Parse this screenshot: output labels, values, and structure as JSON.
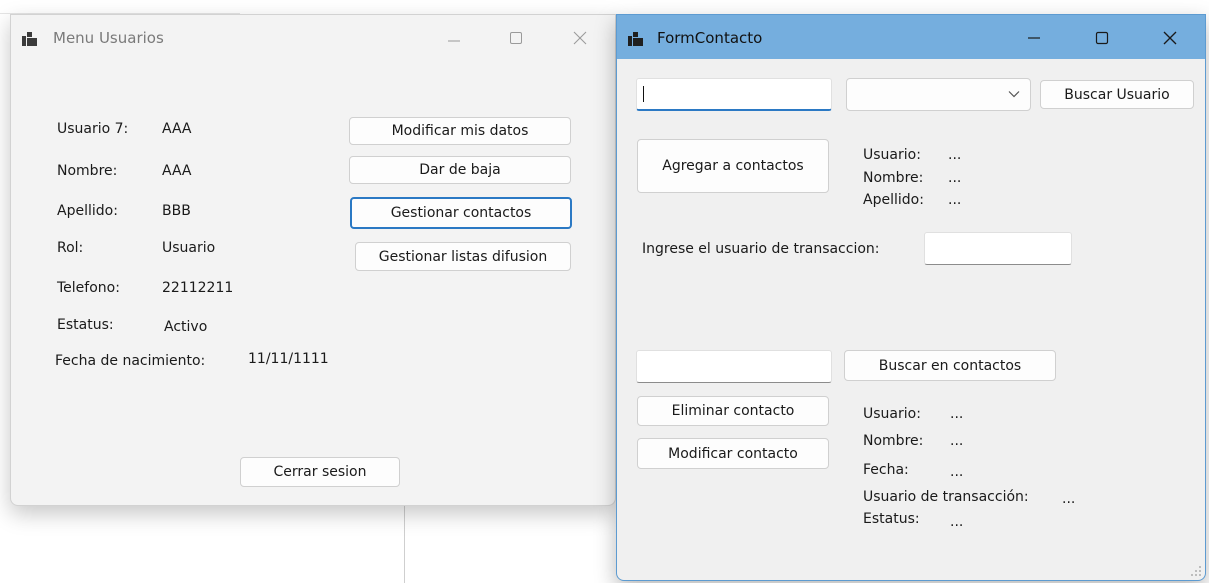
{
  "menu_window": {
    "title": "Menu Usuarios",
    "fields": [
      {
        "label": "Usuario 7:",
        "value": "AAA"
      },
      {
        "label": "Nombre:",
        "value": "AAA"
      },
      {
        "label": "Apellido:",
        "value": "BBB"
      },
      {
        "label": "Rol:",
        "value": "Usuario"
      },
      {
        "label": "Telefono:",
        "value": "22112211"
      },
      {
        "label": "Estatus:",
        "value": "Activo"
      },
      {
        "label": "Fecha de nacimiento:",
        "value": "11/11/1111"
      }
    ],
    "buttons": {
      "modify": "Modificar mis datos",
      "deactivate": "Dar de baja",
      "manage_contacts": "Gestionar contactos",
      "manage_lists": "Gestionar listas difusion",
      "logout": "Cerrar sesion"
    }
  },
  "contact_window": {
    "title": "FormContacto",
    "search_user_input": "",
    "user_combo_value": "",
    "buttons": {
      "search_user": "Buscar Usuario",
      "add_contact": "Agregar a contactos",
      "search_contacts": "Buscar en contactos",
      "delete_contact": "Eliminar contacto",
      "modify_contact": "Modificar contacto"
    },
    "found_user": {
      "usuario_label": "Usuario:",
      "usuario_value": "...",
      "nombre_label": "Nombre:",
      "nombre_value": "...",
      "apellido_label": "Apellido:",
      "apellido_value": "..."
    },
    "transaction_prompt": "Ingrese el usuario de transaccion:",
    "transaction_input": "",
    "contacts_search_input": "",
    "contact_details": {
      "usuario_label": "Usuario:",
      "usuario_value": "...",
      "nombre_label": "Nombre:",
      "nombre_value": "...",
      "fecha_label": "Fecha:",
      "fecha_value": "...",
      "usuario_trans_label": "Usuario de transacción:",
      "usuario_trans_value": "...",
      "estatus_label": "Estatus:",
      "estatus_value": "..."
    }
  },
  "icons": {
    "app": "app-window-icon",
    "minimize": "minimize-icon",
    "maximize": "maximize-icon",
    "close": "close-icon",
    "dropdown": "chevron-down-icon",
    "resize": "resize-grip-icon"
  },
  "colors": {
    "active_titlebar": "#75aede",
    "window_bg": "#f3f3f3",
    "focus_blue": "#2b79c4"
  }
}
